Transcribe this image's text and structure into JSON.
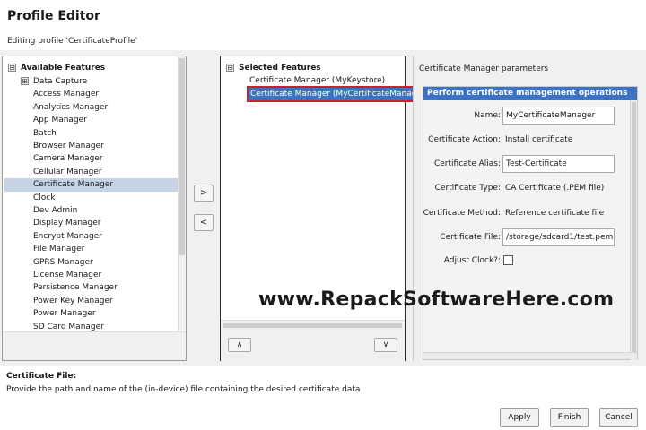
{
  "header": {
    "title": "Profile Editor",
    "subtitle": "Editing profile 'CertificateProfile'"
  },
  "available": {
    "root_label": "Available Features",
    "expander": "⊟",
    "items": [
      {
        "label": "Data Capture",
        "expander": "⊞"
      },
      {
        "label": "Access Manager"
      },
      {
        "label": "Analytics Manager"
      },
      {
        "label": "App Manager"
      },
      {
        "label": "Batch"
      },
      {
        "label": "Browser Manager"
      },
      {
        "label": "Camera Manager"
      },
      {
        "label": "Cellular Manager"
      },
      {
        "label": "Certificate Manager",
        "selected": true
      },
      {
        "label": "Clock"
      },
      {
        "label": "Dev Admin"
      },
      {
        "label": "Display Manager"
      },
      {
        "label": "Encrypt Manager"
      },
      {
        "label": "File Manager"
      },
      {
        "label": "GPRS Manager"
      },
      {
        "label": "License Manager"
      },
      {
        "label": "Persistence Manager"
      },
      {
        "label": "Power Key Manager"
      },
      {
        "label": "Power Manager"
      },
      {
        "label": "SD Card Manager"
      }
    ]
  },
  "move": {
    "add": ">",
    "remove": "<"
  },
  "selected": {
    "root_label": "Selected Features",
    "expander": "⊟",
    "items": [
      {
        "label": "Certificate Manager (MyKeystore)"
      },
      {
        "label": "Certificate Manager (MyCertificateManager)",
        "selected": true
      }
    ],
    "up": "∧",
    "down": "∨"
  },
  "params": {
    "title": "Certificate Manager parameters",
    "header": "Perform certificate management operations",
    "fields": {
      "name": {
        "label": "Name:",
        "value": "MyCertificateManager"
      },
      "action": {
        "label": "Certificate Action:",
        "value": "Install certificate"
      },
      "alias": {
        "label": "Certificate Alias:",
        "value": "Test-Certificate"
      },
      "type": {
        "label": "Certificate Type:",
        "value": "CA Certificate (.PEM file)"
      },
      "method": {
        "label": "Certificate Method:",
        "value": "Reference certificate file"
      },
      "file": {
        "label": "Certificate File:",
        "value": "/storage/sdcard1/test.pem"
      },
      "clock": {
        "label": "Adjust Clock?:",
        "checked": false
      }
    }
  },
  "watermark": "www.RepackSoftwareHere.com",
  "description": {
    "title": "Certificate File:",
    "text": "Provide the path and name of the (in-device) file containing the desired certificate data"
  },
  "buttons": {
    "apply": "Apply",
    "finish": "Finish",
    "cancel": "Cancel"
  },
  "colors": {
    "selection_blue": "#3b73c4",
    "highlight_red": "#cc1f2b",
    "tree_selection": "#c6d3e4"
  }
}
